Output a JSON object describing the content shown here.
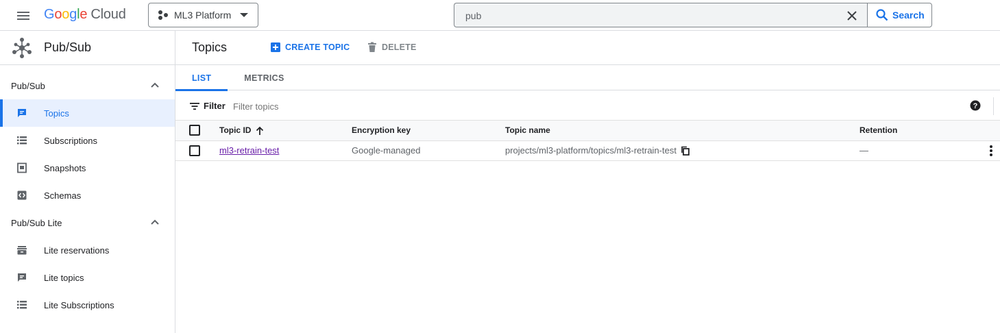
{
  "header": {
    "logo_google": "Google",
    "logo_cloud": "Cloud",
    "project_name": "ML3 Platform",
    "search_value": "pub",
    "search_button_label": "Search"
  },
  "sidebar": {
    "product_title": "Pub/Sub",
    "sections": [
      {
        "label": "Pub/Sub",
        "items": [
          {
            "label": "Topics",
            "icon": "topics-icon",
            "active": true
          },
          {
            "label": "Subscriptions",
            "icon": "list-icon"
          },
          {
            "label": "Snapshots",
            "icon": "snapshot-icon"
          },
          {
            "label": "Schemas",
            "icon": "schema-icon"
          }
        ]
      },
      {
        "label": "Pub/Sub Lite",
        "items": [
          {
            "label": "Lite reservations",
            "icon": "reservation-icon"
          },
          {
            "label": "Lite topics",
            "icon": "topics-icon"
          },
          {
            "label": "Lite Subscriptions",
            "icon": "list-icon"
          }
        ]
      }
    ]
  },
  "main": {
    "page_title": "Topics",
    "create_label": "CREATE TOPIC",
    "delete_label": "DELETE",
    "tabs": [
      {
        "label": "LIST",
        "active": true
      },
      {
        "label": "METRICS"
      }
    ],
    "filter_label": "Filter",
    "filter_placeholder": "Filter topics",
    "table": {
      "columns": [
        "Topic ID",
        "Encryption key",
        "Topic name",
        "Retention"
      ],
      "rows": [
        {
          "topic_id": "ml3-retrain-test",
          "encryption_key": "Google-managed",
          "topic_name": "projects/ml3-platform/topics/ml3-retrain-test",
          "retention": "—"
        }
      ]
    }
  },
  "colors": {
    "accent": "#1a73e8",
    "link_visited": "#681da8",
    "active_bg": "#e8f0fe",
    "border": "#dadce0"
  }
}
